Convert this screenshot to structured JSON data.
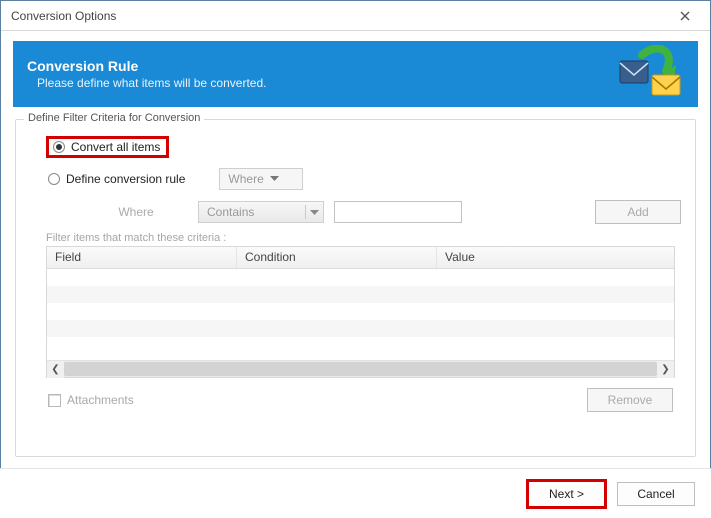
{
  "window": {
    "title": "Conversion Options"
  },
  "banner": {
    "title": "Conversion Rule",
    "subtitle": "Please define what items will be converted."
  },
  "group": {
    "legend": "Define Filter Criteria for Conversion",
    "convert_all_label": "Convert all items",
    "define_rule_label": "Define conversion rule",
    "where_dropdown": "Where",
    "where_row_label": "Where",
    "contains_dropdown": "Contains",
    "add_button": "Add",
    "criteria_hint": "Filter items that match these criteria :",
    "columns": {
      "field": "Field",
      "condition": "Condition",
      "value": "Value"
    },
    "attachments_label": "Attachments",
    "remove_button": "Remove"
  },
  "footer": {
    "next": "Next >",
    "cancel": "Cancel"
  }
}
